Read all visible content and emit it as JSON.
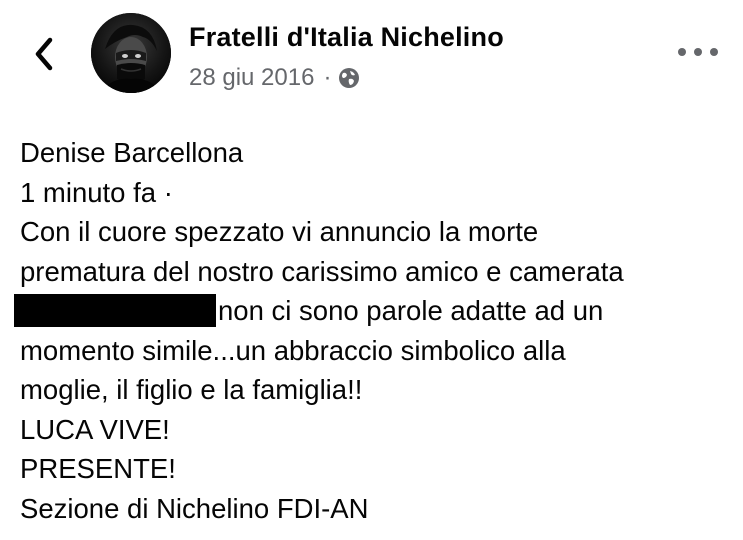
{
  "header": {
    "back_icon": "chevron-left-icon",
    "page_name": "Fratelli d'Italia Nichelino",
    "date": "28 giu 2016",
    "separator": "·",
    "privacy_icon": "globe-icon",
    "more_icon": "more-horizontal-icon"
  },
  "post": {
    "author": "Denise Barcellona",
    "time": "1 minuto fa ·",
    "line_1": "Con il cuore spezzato vi annuncio la morte",
    "line_2": "prematura del nostro carissimo amico e camerata",
    "line_3_after_redaction": "non ci sono parole adatte ad un",
    "line_4": "momento simile...un abbraccio simbolico alla",
    "line_5": "moglie, il figlio e la famiglia!!",
    "line_6": "LUCA VIVE!",
    "line_7": "PRESENTE!",
    "line_8": "Sezione di Nichelino FDI-AN"
  },
  "colors": {
    "text": "#050505",
    "secondary_text": "#65676b",
    "background": "#ffffff",
    "redaction": "#000000"
  }
}
